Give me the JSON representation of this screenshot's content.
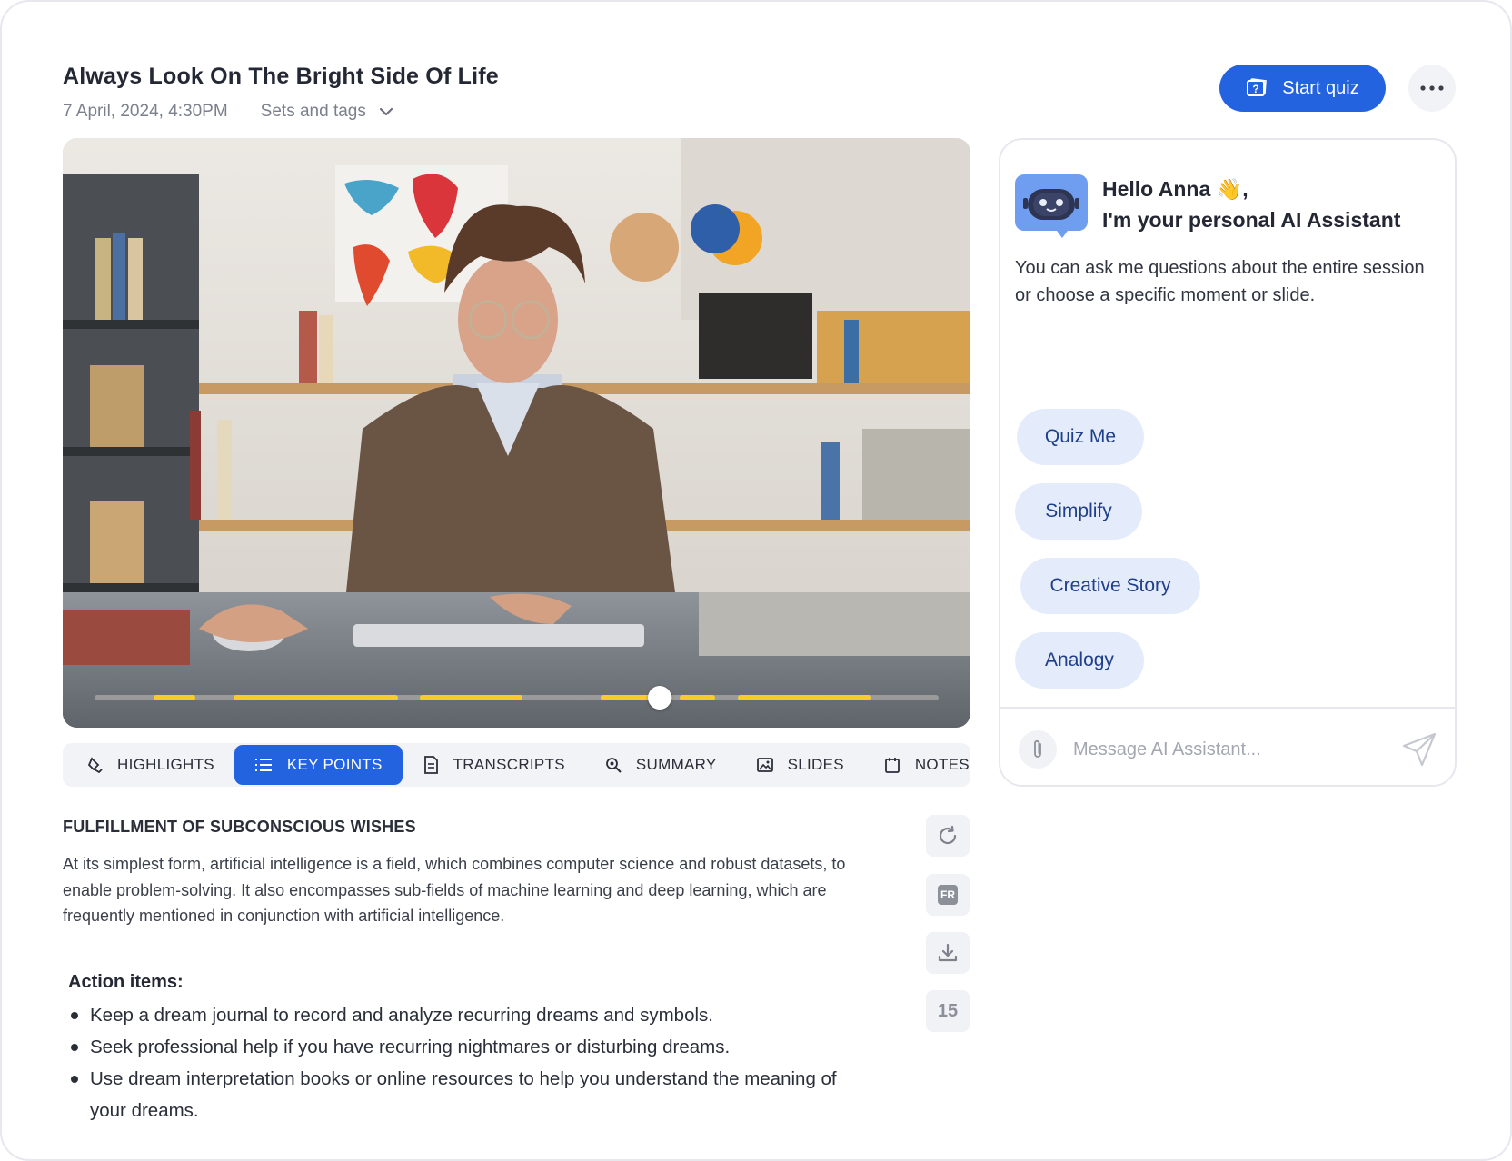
{
  "header": {
    "title": "Always Look On The Bright Side Of Life",
    "date": "7 April, 2024, 4:30PM",
    "sets_label": "Sets and tags",
    "start_quiz_label": "Start quiz"
  },
  "video": {
    "playback_progress": 0.67,
    "highlight_segments": [
      [
        0.07,
        0.12
      ],
      [
        0.165,
        0.36
      ],
      [
        0.385,
        0.507
      ],
      [
        0.6,
        0.685
      ],
      [
        0.693,
        0.735
      ],
      [
        0.762,
        0.92
      ]
    ]
  },
  "tabs": [
    {
      "label": "HIGHLIGHTS",
      "icon": "highlighter-icon",
      "active": false
    },
    {
      "label": "KEY POINTS",
      "icon": "list-icon",
      "active": true
    },
    {
      "label": "TRANSCRIPTS",
      "icon": "document-icon",
      "active": false
    },
    {
      "label": "SUMMARY",
      "icon": "magnifier-icon",
      "active": false
    },
    {
      "label": "SLIDES",
      "icon": "image-icon",
      "active": false
    },
    {
      "label": "NOTES",
      "icon": "notepad-icon",
      "active": false
    }
  ],
  "key_points": {
    "title": "FULFILLMENT OF SUBCONSCIOUS WISHES",
    "body": "At its simplest form, artificial intelligence is a field, which combines computer science and robust datasets, to enable problem-solving. It also encompasses sub-fields of machine learning and deep learning, which are frequently mentioned in conjunction with artificial intelligence.",
    "action_title": "Action items:",
    "action_items": [
      "Keep a dream journal to record and analyze recurring dreams and symbols.",
      "Seek professional help if you have recurring nightmares or disturbing dreams.",
      "Use dream interpretation books or online resources to help you understand the meaning of your dreams."
    ]
  },
  "side_tools": {
    "translate_label": "FR",
    "count": "15"
  },
  "assistant": {
    "greeting_line1": "Hello Anna 👋,",
    "greeting_line2": "I'm your personal AI Assistant",
    "intro": "You can ask me questions about the entire session or choose a specific moment or slide.",
    "chips": [
      "Quiz Me",
      "Simplify",
      "Creative Story",
      "Analogy"
    ],
    "message_placeholder": "Message AI Assistant..."
  },
  "colors": {
    "accent": "#2463e0",
    "chip_bg": "#e4ecfb",
    "chip_text": "#1f3f8a",
    "highlight_segment": "#f7cc28"
  }
}
